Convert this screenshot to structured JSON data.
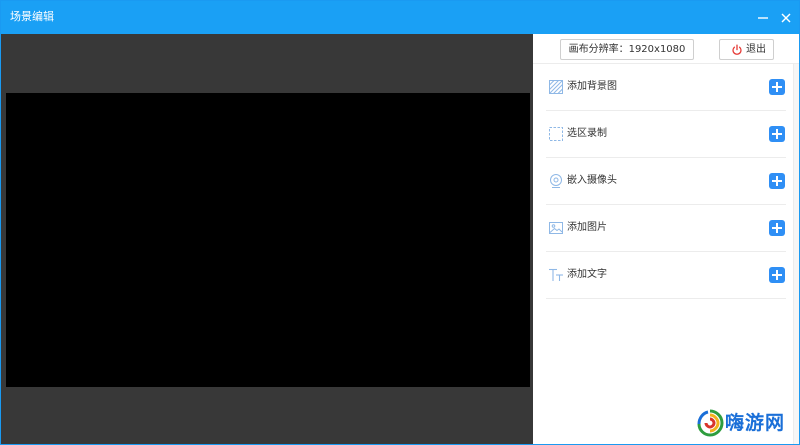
{
  "window": {
    "title": "场景编辑",
    "colors": {
      "titlebar": "#1aa0f5",
      "stage": "#383838",
      "canvas": "#000000",
      "accent": "#2f8ff5"
    }
  },
  "panel": {
    "resolution_label": "画布分辨率：1920x1080",
    "exit_label": "退出",
    "items": [
      {
        "label": "添加背景图",
        "icon": "background-image-icon"
      },
      {
        "label": "选区录制",
        "icon": "region-select-icon"
      },
      {
        "label": "嵌入摄像头",
        "icon": "camera-icon"
      },
      {
        "label": "添加图片",
        "icon": "image-icon"
      },
      {
        "label": "添加文字",
        "icon": "text-icon"
      }
    ]
  },
  "watermark": {
    "text": "嗨游网"
  }
}
